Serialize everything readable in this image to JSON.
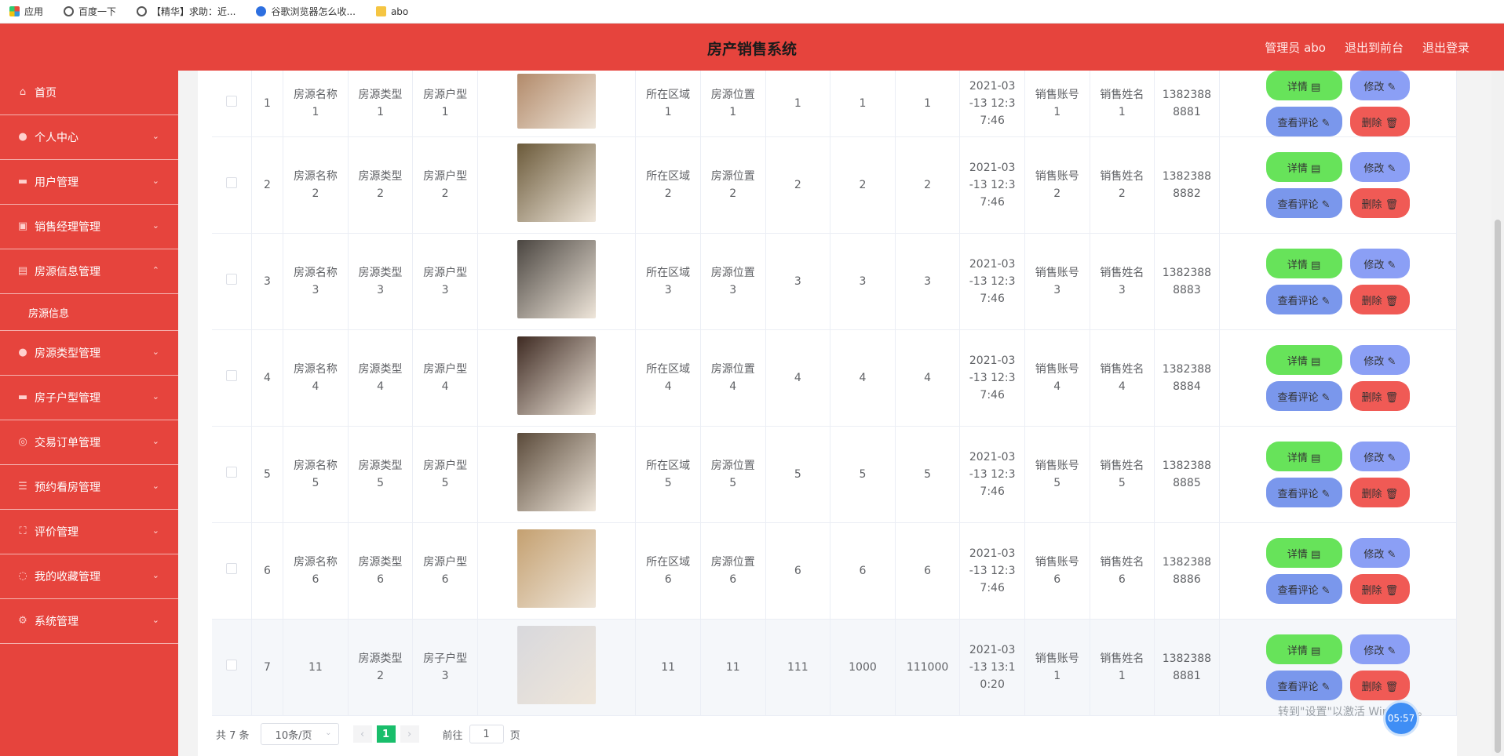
{
  "bookmarks": [
    {
      "icon": "apps-icon",
      "label": "应用"
    },
    {
      "icon": "globe-icon",
      "label": "百度一下"
    },
    {
      "icon": "globe-icon",
      "label": "【精华】求助：近..."
    },
    {
      "icon": "paw-icon",
      "label": "谷歌浏览器怎么收..."
    },
    {
      "icon": "folder-icon",
      "label": "abo"
    }
  ],
  "header": {
    "title": "房产销售系统",
    "admin": "管理员 abo",
    "front": "退出到前台",
    "logout": "退出登录",
    "color": "#e6443d"
  },
  "sidebar": {
    "items": [
      {
        "label": "首页",
        "icon": "home-icon"
      },
      {
        "label": "个人中心",
        "icon": "user-icon"
      },
      {
        "label": "用户管理",
        "icon": "users-icon"
      },
      {
        "label": "销售经理管理",
        "icon": "briefcase-icon"
      },
      {
        "label": "房源信息管理",
        "icon": "house-icon"
      },
      {
        "label": "房源信息",
        "icon": ""
      },
      {
        "label": "房源类型管理",
        "icon": "type-icon"
      },
      {
        "label": "房子户型管理",
        "icon": "layout-icon"
      },
      {
        "label": "交易订单管理",
        "icon": "order-icon"
      },
      {
        "label": "预约看房管理",
        "icon": "calendar-icon"
      },
      {
        "label": "评价管理",
        "icon": "comment-icon"
      },
      {
        "label": "我的收藏管理",
        "icon": "star-icon"
      },
      {
        "label": "系统管理",
        "icon": "gear-icon"
      }
    ]
  },
  "buttons": {
    "detail": "详情 ▤",
    "edit": "修改 ✎",
    "review": "查看评论 ✎",
    "delete": "删除 🗑"
  },
  "rows": [
    {
      "idx": "1",
      "name": "房源名称\n1",
      "type": "房源类型\n1",
      "layout": "房源户型\n1",
      "region": "所在区域\n1",
      "loc": "房源位置\n1",
      "a": "1",
      "b": "1",
      "c": "1",
      "time": "2021-03\n-13 12:3\n7:46",
      "acct": "销售账号\n1",
      "sname": "销售姓名\n1",
      "phone": "1382388\n8881",
      "img": "#b28a6a"
    },
    {
      "idx": "2",
      "name": "房源名称\n2",
      "type": "房源类型\n2",
      "layout": "房源户型\n2",
      "region": "所在区域\n2",
      "loc": "房源位置\n2",
      "a": "2",
      "b": "2",
      "c": "2",
      "time": "2021-03\n-13 12:3\n7:46",
      "acct": "销售账号\n2",
      "sname": "销售姓名\n2",
      "phone": "1382388\n8882",
      "img": "#6b5a3a"
    },
    {
      "idx": "3",
      "name": "房源名称\n3",
      "type": "房源类型\n3",
      "layout": "房源户型\n3",
      "region": "所在区域\n3",
      "loc": "房源位置\n3",
      "a": "3",
      "b": "3",
      "c": "3",
      "time": "2021-03\n-13 12:3\n7:46",
      "acct": "销售账号\n3",
      "sname": "销售姓名\n3",
      "phone": "1382388\n8883",
      "img": "#4a4540"
    },
    {
      "idx": "4",
      "name": "房源名称\n4",
      "type": "房源类型\n4",
      "layout": "房源户型\n4",
      "region": "所在区域\n4",
      "loc": "房源位置\n4",
      "a": "4",
      "b": "4",
      "c": "4",
      "time": "2021-03\n-13 12:3\n7:46",
      "acct": "销售账号\n4",
      "sname": "销售姓名\n4",
      "phone": "1382388\n8884",
      "img": "#3e2a22"
    },
    {
      "idx": "5",
      "name": "房源名称\n5",
      "type": "房源类型\n5",
      "layout": "房源户型\n5",
      "region": "所在区域\n5",
      "loc": "房源位置\n5",
      "a": "5",
      "b": "5",
      "c": "5",
      "time": "2021-03\n-13 12:3\n7:46",
      "acct": "销售账号\n5",
      "sname": "销售姓名\n5",
      "phone": "1382388\n8885",
      "img": "#5a4a3a"
    },
    {
      "idx": "6",
      "name": "房源名称\n6",
      "type": "房源类型\n6",
      "layout": "房源户型\n6",
      "region": "所在区域\n6",
      "loc": "房源位置\n6",
      "a": "6",
      "b": "6",
      "c": "6",
      "time": "2021-03\n-13 12:3\n7:46",
      "acct": "销售账号\n6",
      "sname": "销售姓名\n6",
      "phone": "1382388\n8886",
      "img": "#c4a070"
    },
    {
      "idx": "7",
      "name": "11",
      "type": "房源类型\n2",
      "layout": "房子户型\n3",
      "region": "11",
      "loc": "11",
      "a": "111",
      "b": "1000",
      "c": "111000",
      "time": "2021-03\n-13 13:1\n0:20",
      "acct": "销售账号\n1",
      "sname": "销售姓名\n1",
      "phone": "1382388\n8881",
      "img": "#d8d8dc"
    }
  ],
  "pager": {
    "total": "共 7 条",
    "size": "10条/页",
    "page": "1",
    "goto": "前往",
    "goto_val": "1",
    "page_unit": "页"
  },
  "overlay": {
    "watermark": "转到\"设置\"以激活 Windows。",
    "clock": "05:57"
  }
}
